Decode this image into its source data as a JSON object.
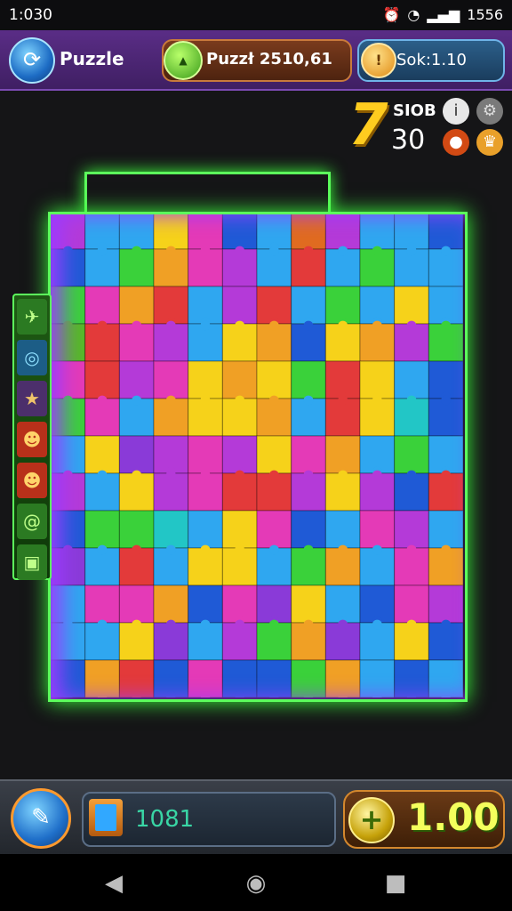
{
  "status_bar": {
    "time": "1:030",
    "battery": "1556",
    "icons": [
      "alarm-icon",
      "wifi-icon",
      "wifi-icon",
      "signal-icon"
    ]
  },
  "top_bar": {
    "title": "Puzzle",
    "puzzle_counter": "Puzzł 2510,61",
    "sok_counter": "Sok:1.10"
  },
  "hud": {
    "level": "7",
    "stat_label": "SIOB",
    "stat_value": "30"
  },
  "board": {
    "rows": 13,
    "cols": 12,
    "palette": [
      "#e33a3a",
      "#f0a025",
      "#f6d21a",
      "#3ad13a",
      "#2fa7f0",
      "#1f5ad6",
      "#b43ad8",
      "#e43ab7",
      "#22c6c6",
      "#8a3ad8",
      "#56b928",
      "#e06b20"
    ],
    "tiles": [
      [
        6,
        4,
        4,
        2,
        7,
        5,
        4,
        11,
        6,
        4,
        4,
        5
      ],
      [
        5,
        4,
        3,
        1,
        7,
        6,
        4,
        0,
        4,
        3,
        4,
        4
      ],
      [
        3,
        7,
        1,
        0,
        4,
        6,
        0,
        4,
        3,
        4,
        2,
        4
      ],
      [
        10,
        0,
        7,
        6,
        4,
        2,
        1,
        5,
        2,
        1,
        6,
        3
      ],
      [
        7,
        0,
        6,
        7,
        2,
        1,
        2,
        3,
        0,
        2,
        4,
        5
      ],
      [
        3,
        7,
        4,
        1,
        2,
        2,
        1,
        4,
        0,
        2,
        8,
        5
      ],
      [
        4,
        2,
        9,
        6,
        7,
        6,
        2,
        7,
        1,
        4,
        3,
        4
      ],
      [
        6,
        4,
        2,
        6,
        7,
        0,
        0,
        6,
        2,
        6,
        5,
        0
      ],
      [
        5,
        3,
        3,
        8,
        4,
        2,
        7,
        5,
        4,
        7,
        6,
        4
      ],
      [
        9,
        4,
        0,
        4,
        2,
        2,
        4,
        3,
        1,
        4,
        7,
        1
      ],
      [
        4,
        7,
        7,
        1,
        5,
        7,
        9,
        2,
        4,
        5,
        7,
        6
      ],
      [
        4,
        4,
        2,
        9,
        4,
        6,
        3,
        1,
        9,
        4,
        2,
        5
      ],
      [
        5,
        1,
        0,
        5,
        7,
        5,
        5,
        3,
        1,
        4,
        5,
        4
      ]
    ]
  },
  "side_strip": [
    {
      "icon": "plane-icon"
    },
    {
      "icon": "globe-icon"
    },
    {
      "icon": "star-icon"
    },
    {
      "icon": "face-icon"
    },
    {
      "icon": "face-icon"
    },
    {
      "icon": "swirl-icon"
    },
    {
      "icon": "box-icon"
    }
  ],
  "bottom_bar": {
    "pieces_count": "1081",
    "coin_value": "1.00"
  }
}
